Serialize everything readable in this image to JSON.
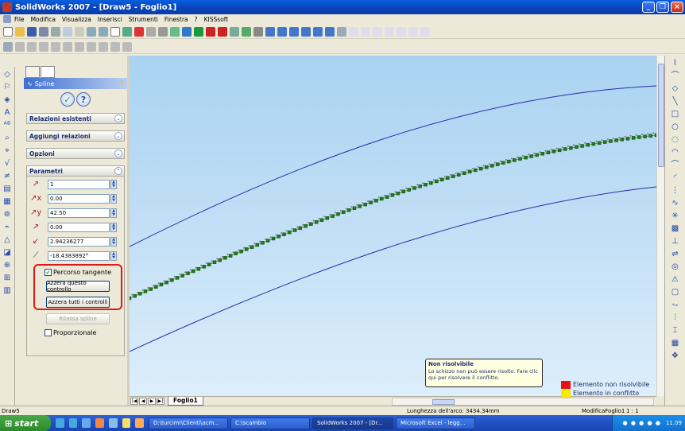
{
  "window": {
    "title": "SolidWorks 2007 - [Draw5 - Foglio1]"
  },
  "menu": [
    "File",
    "Modifica",
    "Visualizza",
    "Inserisci",
    "Strumenti",
    "Finestra",
    "?",
    "KISSsoft"
  ],
  "pm": {
    "title": "Spline",
    "help": "?",
    "sections": {
      "relations": "Relazioni esistenti",
      "add_relations": "Aggiungi relazioni",
      "options": "Opzioni",
      "params": "Parametri"
    },
    "fields": [
      "1",
      "0.00",
      "42.50",
      "0.00",
      "2.94236277",
      "-18.4383892°"
    ],
    "tangent_label": "Percorso tangente",
    "reset_one": "Azzera questo controllo",
    "reset_all": "Azzera tutti i controlli",
    "relax": "Rilassa spline",
    "proportional": "Proporzionale"
  },
  "sheet_tab": "Foglio1",
  "tooltip": {
    "title": "Non risolvibile",
    "text": "Lo schizzo non può essere risolto. Fare clic qui per risolvere il conflitto."
  },
  "legend": [
    {
      "label": "Elemento non risolvibile",
      "color": "#ee1111"
    },
    {
      "label": "Elemento in conflitto",
      "color": "#f5ea00"
    }
  ],
  "status": {
    "left": "Draw5",
    "arc": "Lunghezza dell'arco: 3434.34mm",
    "sheet": "ModificaFoglio1",
    "scale": "1 : 1"
  },
  "taskbar": {
    "start": "start",
    "items": [
      "D:\\turcimi\\Clienti\\acm...",
      "C:\\scambio",
      "SolidWorks 2007 - [Dr...",
      "Microsoft Excel - legg..."
    ],
    "clock": "11.09"
  }
}
